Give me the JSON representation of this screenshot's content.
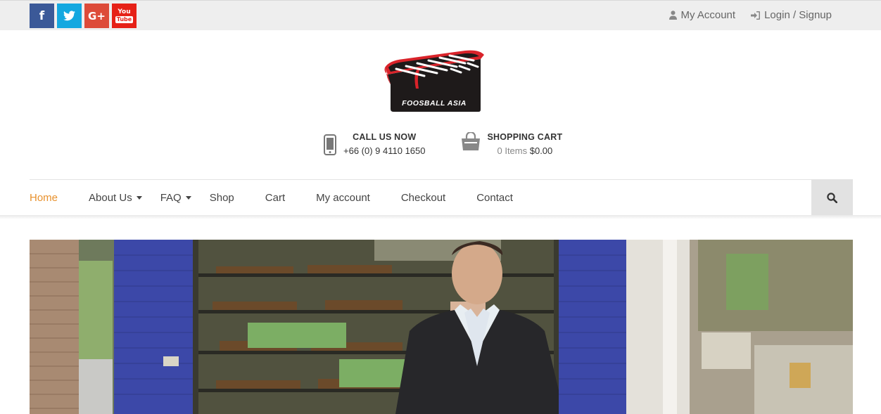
{
  "topbar": {
    "social": [
      {
        "name": "facebook",
        "label": "f",
        "color": "#3b5998"
      },
      {
        "name": "twitter",
        "label": "",
        "color": "#14a8e0"
      },
      {
        "name": "google-plus",
        "label": "G+",
        "color": "#dd4b39"
      },
      {
        "name": "youtube",
        "label": "You Tube",
        "color": "#e62117"
      }
    ],
    "my_account": "My Account",
    "login_signup": "Login / Signup"
  },
  "logo": {
    "text": "FOOSBALL ASIA"
  },
  "contact": {
    "call_title": "CALL US NOW",
    "call_number": "+66 (0) 9 4110 1650",
    "cart_title": "SHOPPING CART",
    "cart_items": "0 Items",
    "cart_total": "$0.00"
  },
  "nav": {
    "items": [
      {
        "label": "Home",
        "active": true,
        "dropdown": false
      },
      {
        "label": "About Us",
        "active": false,
        "dropdown": true
      },
      {
        "label": "FAQ",
        "active": false,
        "dropdown": true
      },
      {
        "label": "Shop",
        "active": false,
        "dropdown": false
      },
      {
        "label": "Cart",
        "active": false,
        "dropdown": false
      },
      {
        "label": "My account",
        "active": false,
        "dropdown": false
      },
      {
        "label": "Checkout",
        "active": false,
        "dropdown": false
      },
      {
        "label": "Contact",
        "active": false,
        "dropdown": false
      }
    ],
    "active_color": "#e8912d"
  },
  "hero": {
    "image": "photo of man in suit seated in front of foosball table display"
  }
}
